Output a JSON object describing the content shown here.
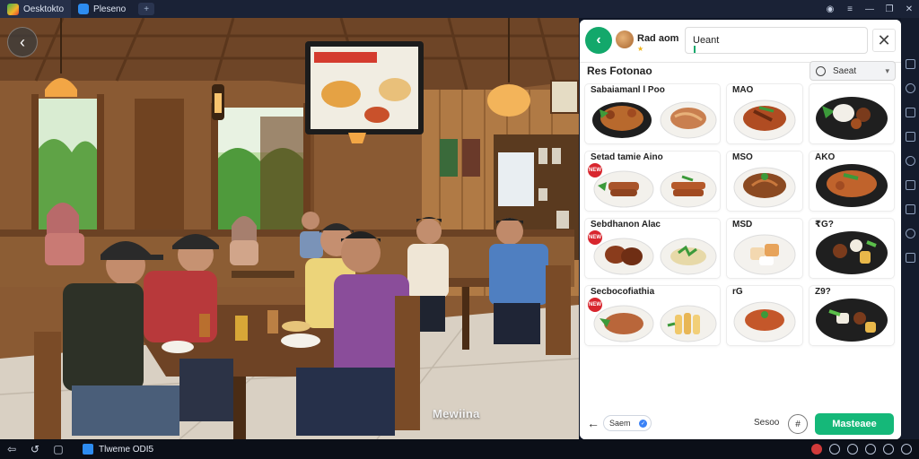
{
  "titlebar": {
    "tab1_label": "Oesktokto",
    "tab2_label": "Pleseno",
    "add_tab": "+",
    "controls": [
      "◉",
      "≡",
      "—",
      "❐",
      "✕"
    ]
  },
  "panel": {
    "header_name": "Rad aom",
    "header_rating": "★",
    "search_value": "Ueant",
    "close_label": "✕",
    "section_title": "Res Fotonao",
    "sort_label": "Saeat",
    "rows": [
      {
        "labels": [
          "Sabaiamanl l Poo",
          "MAO",
          "",
          ""
        ],
        "badge": ""
      },
      {
        "labels": [
          "Setad tamie Aino",
          "MSO",
          "AKO",
          ""
        ],
        "badge": "NEW"
      },
      {
        "labels": [
          "Sebdhanon Alac",
          "MSD",
          "₹G?",
          ""
        ],
        "badge": "NEW"
      },
      {
        "labels": [
          "Secbocofiathia",
          "rG",
          "Z9?",
          ""
        ],
        "badge": "NEW"
      }
    ],
    "footer": {
      "back": "←",
      "chip_label": "Saem",
      "text": "Sesoo",
      "filter_label": "#",
      "primary_button": "Masteaee"
    }
  },
  "scene": {
    "back_label": "‹",
    "watermark": "Mewiina"
  },
  "taskbar": {
    "app_label": "Tlweme ODI5",
    "nav": [
      "⇦",
      "↺",
      "▢"
    ]
  }
}
